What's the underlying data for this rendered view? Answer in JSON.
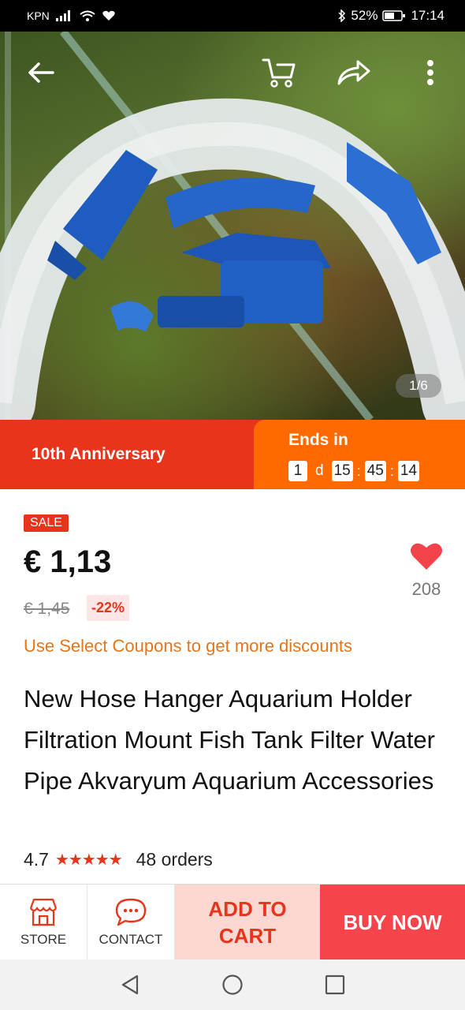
{
  "status_bar": {
    "carrier": "KPN",
    "battery": "52%",
    "time": "17:14"
  },
  "hero": {
    "image_counter": "1/6",
    "icons": [
      "back-arrow-icon",
      "cart-icon",
      "share-icon",
      "more-icon"
    ]
  },
  "promo": {
    "label": "10th Anniversary",
    "ends_label": "Ends in",
    "countdown": {
      "days": "1",
      "days_unit": "d",
      "hours": "15",
      "minutes": "45",
      "seconds": "14",
      "separator": ":"
    }
  },
  "product": {
    "sale_badge": "SALE",
    "price": "€ 1,13",
    "original_price": "€ 1,45",
    "discount": "-22%",
    "wishlist_count": "208",
    "coupon_text": "Use Select Coupons to get more discounts",
    "title": "New Hose Hanger Aquarium Holder Filtration Mount Fish Tank Filter Water Pipe Akvaryum Aquarium Accessories",
    "rating": "4.7",
    "stars": "★★★★★",
    "orders": "48 orders"
  },
  "bottom_bar": {
    "store_label": "STORE",
    "contact_label": "CONTACT",
    "add_to_cart_label": "ADD TO CART",
    "buy_now_label": "BUY NOW"
  },
  "colors": {
    "accent": "#e8341a",
    "orange": "#ff6a00",
    "coupon": "#e8741a",
    "buy_now": "#f5454a",
    "add_to_cart_bg": "#fdd8d3"
  }
}
